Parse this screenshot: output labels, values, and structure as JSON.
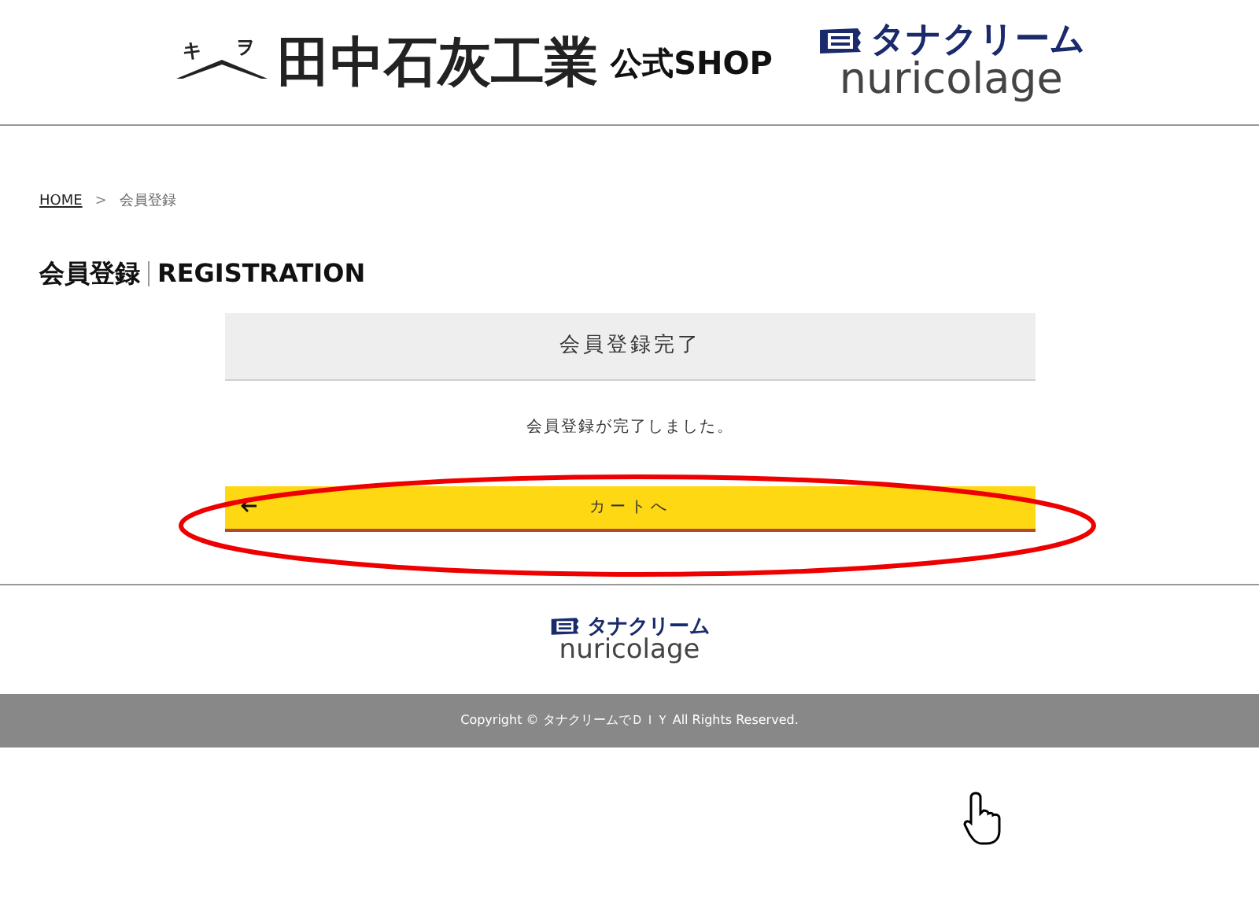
{
  "header": {
    "logo_marks": [
      "キ",
      "ヲ"
    ],
    "company": "田中石灰工業",
    "shop_label": "公式SHOP",
    "brand_katakana": "タナクリーム",
    "brand_name": "nuricolage"
  },
  "breadcrumb": [
    {
      "label": "HOME",
      "kind": "link"
    },
    {
      "label": ">",
      "kind": "separator"
    },
    {
      "label": "会員登録",
      "kind": "current"
    }
  ],
  "page_title": {
    "japanese": "会員登録",
    "english": "REGISTRATION"
  },
  "panel": {
    "heading": "会員登録完了",
    "message": "会員登録が完了しました。",
    "button": "カートへ"
  },
  "footer": {
    "brand_katakana": "タナクリーム",
    "brand_name": "nuricolage",
    "copyright": "Copyright © タナクリームでＤＩＹ All Rights Reserved."
  }
}
